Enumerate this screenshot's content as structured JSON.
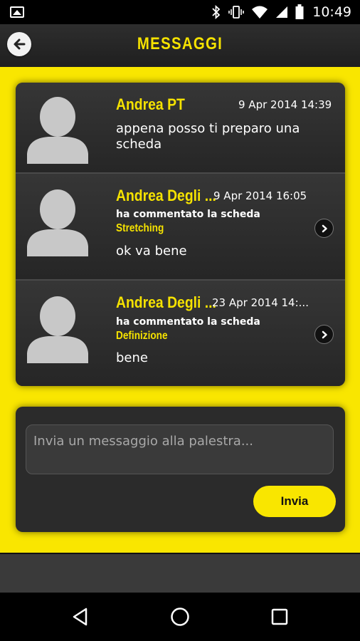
{
  "status_bar": {
    "time": "10:49",
    "icons": [
      "image-icon",
      "bluetooth-icon",
      "vibrate-icon",
      "wifi-icon",
      "signal-icon",
      "battery-icon"
    ]
  },
  "header": {
    "title": "MESSAGGI",
    "back_icon": "arrow-left-icon"
  },
  "messages": [
    {
      "sender": "Andrea PT",
      "date": "9 Apr 2014 14:39",
      "text": "appena posso ti preparo una scheda"
    },
    {
      "sender": "Andrea Degli ...",
      "date": "9 Apr 2014 16:05",
      "subtitle": "ha commentato la scheda",
      "scheda": "Stretching",
      "text": "ok va bene",
      "has_arrow": true
    },
    {
      "sender": "Andrea Degli ...",
      "date": "23 Apr 2014 14:...",
      "subtitle": "ha commentato la scheda",
      "scheda": "Definizione",
      "text": "bene",
      "has_arrow": true
    }
  ],
  "composer": {
    "placeholder": "Invia un messaggio alla palestra...",
    "value": "",
    "send_label": "Invia"
  },
  "colors": {
    "accent": "#f9e600",
    "card": "#2a2a2a",
    "header": "#262626"
  },
  "nav_bar": {
    "icons": [
      "back-triangle-icon",
      "home-circle-icon",
      "recents-square-icon"
    ]
  }
}
